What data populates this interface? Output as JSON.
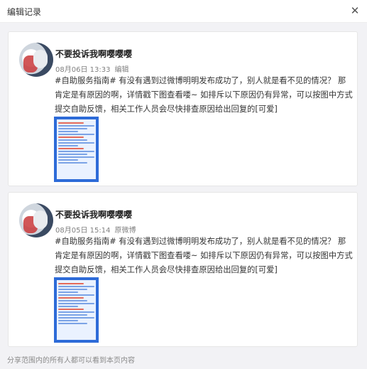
{
  "dialog": {
    "title": "编辑记录",
    "close_icon": "close-icon"
  },
  "records": [
    {
      "user_name": "不要投诉我啊嘤嘤嘤",
      "timestamp": "08月06日 13:33",
      "action": "编辑",
      "text": "#自助服务指南# 有没有遇到过微博明明发布成功了，别人就是看不见的情况？ 那肯定是有原因的啊，详情戳下图查看喽~ 如排斥以下原因仍有异常，可以按图中方式提交自助反馈，相关工作人员会尽快排查原因给出回复的[可爱]",
      "image_icon": "infographic-image"
    },
    {
      "user_name": "不要投诉我啊嘤嘤嘤",
      "timestamp": "08月05日 15:14",
      "action": "原微博",
      "text": "#自助服务指南# 有没有遇到过微博明明发布成功了，别人就是看不见的情况？ 那肯定是有原因的啊，详情戳下图查看喽~ 如排斥以下原因仍有异常，可以按图中方式提交自助反馈，相关工作人员会尽快排查原因给出回复的[可爱]",
      "image_icon": "infographic-image"
    }
  ],
  "footer": {
    "note": "分享范围内的所有人都可以看到本页内容"
  },
  "colors": {
    "background": "#f2f2f5",
    "card": "#ffffff",
    "image_blue": "#2d6bd8"
  }
}
